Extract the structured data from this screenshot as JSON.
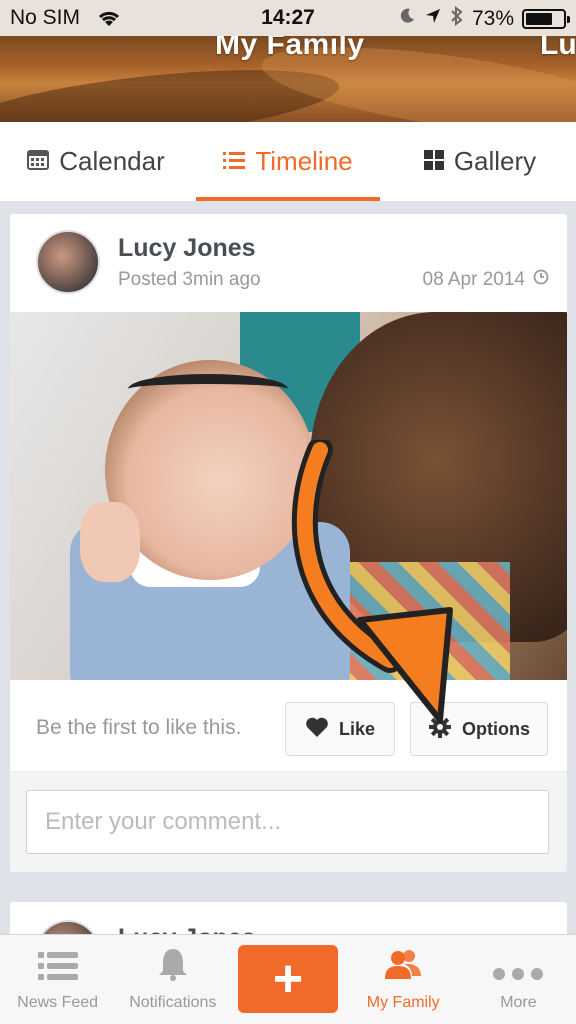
{
  "status_bar": {
    "carrier": "No SIM",
    "time": "14:27",
    "battery": "73%",
    "battery_level": 0.73
  },
  "header": {
    "title": "My Family",
    "title_partial": "Lu"
  },
  "tabs": [
    {
      "label": "Calendar",
      "icon": "calendar-icon"
    },
    {
      "label": "Timeline",
      "icon": "list-icon",
      "active": true
    },
    {
      "label": "Gallery",
      "icon": "grid-icon"
    }
  ],
  "post": {
    "author": "Lucy Jones",
    "posted": "Posted 3min ago",
    "date": "08 Apr 2014",
    "likes_text": "Be the first to like this.",
    "like_label": "Like",
    "options_label": "Options",
    "comment_placeholder": "Enter your comment..."
  },
  "next_post": {
    "author": "Lucy Jones"
  },
  "tab_bar": {
    "items": [
      {
        "label": "News Feed",
        "icon": "news-feed-icon"
      },
      {
        "label": "Notifications",
        "icon": "bell-icon"
      },
      {
        "label": "My Family",
        "icon": "family-icon",
        "active": true
      },
      {
        "label": "More",
        "icon": "more-icon"
      }
    ],
    "add_label": "+"
  },
  "colors": {
    "accent": "#f26a2a",
    "arrow": "#f47d20"
  }
}
